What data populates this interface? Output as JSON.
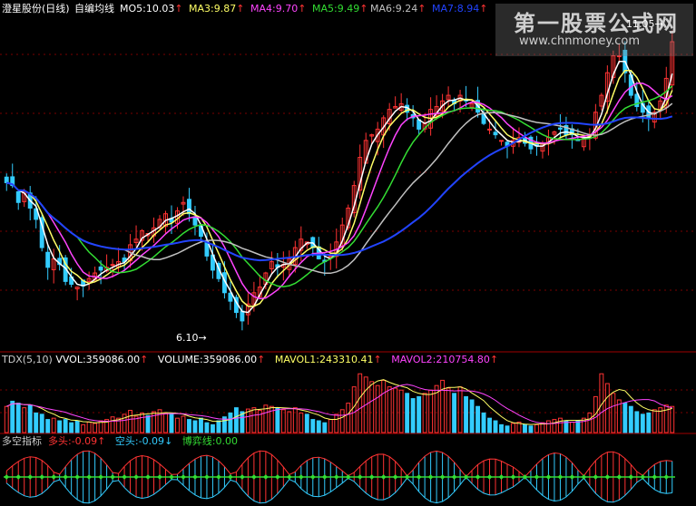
{
  "header": {
    "stock_name": "澄星股份(日线)",
    "indicator_name": "自编均线",
    "ma_labels": [
      {
        "text": "MO5:10.03",
        "color": "#ffffff"
      },
      {
        "text": "MA3:9.87",
        "color": "#ffff66"
      },
      {
        "text": "MA4:9.70",
        "color": "#ff44ff"
      },
      {
        "text": "MA5:9.49",
        "color": "#33dd33"
      },
      {
        "text": "MA6:9.24",
        "color": "#c0c0c0"
      },
      {
        "text": "MA7:8.94",
        "color": "#2244ff"
      }
    ],
    "up_arrow": "↑",
    "down_arrow": "↓"
  },
  "watermark": {
    "title": "第一股票公式网",
    "url": "www.chnmoney.com"
  },
  "annotations": {
    "low_label": "6.10",
    "high_label": "11.05",
    "arrow_right": "→"
  },
  "volume_header": {
    "labels": [
      {
        "text": "TDX(5,10)",
        "color": "#cccccc"
      },
      {
        "text": "VVOL:359086.00",
        "color": "#ffffff"
      },
      {
        "text": "VOLUME:359086.00",
        "color": "#ffffff"
      },
      {
        "text": "MAVOL1:243310.41",
        "color": "#ffff66"
      },
      {
        "text": "MAVOL2:210754.80",
        "color": "#ff44ff"
      }
    ]
  },
  "indicator_header": {
    "labels": [
      {
        "text": "多空指标",
        "color": "#cccccc"
      },
      {
        "text": "多头:-0.09",
        "color": "#ff3333"
      },
      {
        "text": "空头:-0.09",
        "color": "#33ccff"
      },
      {
        "text": "博弈线:0.00",
        "color": "#33dd33"
      }
    ]
  },
  "colors": {
    "up": "#ff3333",
    "down": "#33ccff",
    "grid": "#7a0000",
    "ma": [
      "#ffffff",
      "#ffff66",
      "#ff44ff",
      "#33dd33",
      "#c0c0c0",
      "#2244ff"
    ]
  },
  "chart_data": {
    "type": "candlestick",
    "price_range": [
      5.6,
      11.5
    ],
    "low_point": 6.1,
    "high_point": 11.05,
    "close": [
      8.55,
      8.5,
      8.2,
      8.4,
      8.1,
      7.9,
      7.4,
      7.05,
      7.2,
      7.1,
      6.8,
      6.75,
      6.7,
      6.72,
      6.85,
      6.95,
      7.0,
      7.05,
      7.1,
      7.15,
      7.15,
      7.45,
      7.55,
      7.7,
      7.65,
      7.75,
      7.9,
      8.0,
      7.85,
      8.05,
      8.2,
      8.0,
      7.8,
      7.6,
      7.25,
      7.0,
      6.85,
      6.6,
      6.45,
      6.25,
      6.1,
      6.4,
      6.6,
      6.7,
      6.95,
      7.15,
      7.05,
      7.1,
      7.2,
      7.4,
      7.55,
      7.5,
      7.4,
      7.2,
      7.15,
      7.25,
      7.5,
      7.8,
      8.1,
      8.5,
      9.0,
      9.3,
      9.4,
      9.5,
      9.7,
      9.85,
      9.9,
      9.95,
      9.8,
      9.7,
      9.5,
      9.6,
      9.85,
      9.9,
      10.0,
      10.1,
      9.95,
      10.1,
      10.0,
      9.95,
      9.8,
      9.6,
      9.5,
      9.4,
      9.3,
      9.2,
      9.3,
      9.35,
      9.25,
      9.15,
      9.2,
      9.25,
      9.35,
      9.45,
      9.5,
      9.4,
      9.4,
      9.3,
      9.35,
      9.4,
      9.8,
      10.1,
      10.5,
      10.8,
      10.8,
      10.5,
      10.1,
      9.9,
      9.8,
      9.7,
      9.8,
      10.0,
      10.4,
      11.05
    ],
    "volume_scale": [
      0,
      1000000
    ],
    "volume": [
      0.4,
      0.48,
      0.45,
      0.38,
      0.42,
      0.3,
      0.28,
      0.2,
      0.22,
      0.18,
      0.2,
      0.15,
      0.18,
      0.12,
      0.16,
      0.14,
      0.18,
      0.2,
      0.24,
      0.22,
      0.28,
      0.34,
      0.25,
      0.3,
      0.26,
      0.32,
      0.35,
      0.3,
      0.28,
      0.22,
      0.25,
      0.2,
      0.18,
      0.22,
      0.15,
      0.12,
      0.18,
      0.24,
      0.3,
      0.38,
      0.32,
      0.36,
      0.38,
      0.34,
      0.42,
      0.4,
      0.38,
      0.35,
      0.32,
      0.38,
      0.3,
      0.28,
      0.2,
      0.18,
      0.15,
      0.2,
      0.28,
      0.35,
      0.45,
      0.7,
      0.9,
      0.85,
      0.78,
      0.72,
      0.8,
      0.7,
      0.68,
      0.65,
      0.6,
      0.52,
      0.55,
      0.6,
      0.65,
      0.72,
      0.8,
      0.68,
      0.6,
      0.7,
      0.55,
      0.5,
      0.4,
      0.3,
      0.22,
      0.18,
      0.12,
      0.1,
      0.14,
      0.16,
      0.12,
      0.1,
      0.12,
      0.15,
      0.18,
      0.2,
      0.22,
      0.18,
      0.16,
      0.18,
      0.22,
      0.3,
      0.55,
      0.9,
      0.75,
      0.6,
      0.5,
      0.45,
      0.4,
      0.32,
      0.28,
      0.3,
      0.35,
      0.38,
      0.42,
      0.4
    ]
  }
}
